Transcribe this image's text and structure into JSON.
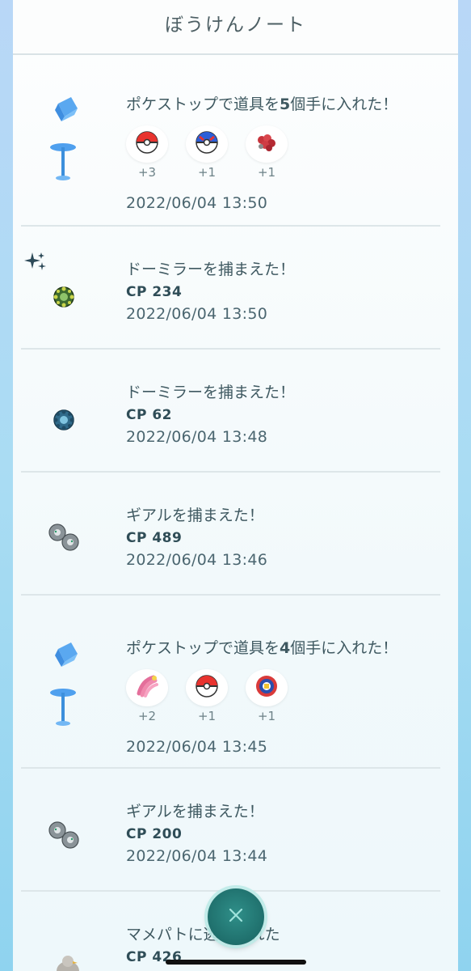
{
  "header": {
    "title": "ぼうけんノート"
  },
  "entries": [
    {
      "type": "pokestop",
      "message_pre": "ポケストップで道具を",
      "message_num": "5",
      "message_post": "個手に入れた！",
      "items": [
        {
          "icon": "poke-ball-icon",
          "count": "+3"
        },
        {
          "icon": "great-ball-icon",
          "count": "+1"
        },
        {
          "icon": "razz-berry-icon",
          "count": "+1"
        }
      ],
      "time": "2022/06/04 13:50"
    },
    {
      "type": "catch",
      "message": "ドーミラーを捕まえた！",
      "cp": "CP 234",
      "time": "2022/06/04 13:50",
      "shiny": true,
      "icon": "bronzor-icon"
    },
    {
      "type": "catch",
      "message": "ドーミラーを捕まえた！",
      "cp": "CP 62",
      "time": "2022/06/04 13:48",
      "icon": "bronzor-icon"
    },
    {
      "type": "catch",
      "message": "ギアルを捕まえた！",
      "cp": "CP 489",
      "time": "2022/06/04 13:46",
      "icon": "klink-icon"
    },
    {
      "type": "pokestop",
      "message_pre": "ポケストップで道具を",
      "message_num": "4",
      "message_post": "個手に入れた！",
      "items": [
        {
          "icon": "nanab-berry-icon",
          "count": "+2"
        },
        {
          "icon": "poke-ball-icon",
          "count": "+1"
        },
        {
          "icon": "gift-icon",
          "count": "+1"
        }
      ],
      "time": "2022/06/04 13:45"
    },
    {
      "type": "catch",
      "message": "ギアルを捕まえた！",
      "cp": "CP 200",
      "time": "2022/06/04 13:44",
      "icon": "klink-icon"
    },
    {
      "type": "fled",
      "message": "マメパトに逃げられた",
      "cp": "CP 426",
      "icon": "pidove-icon"
    }
  ],
  "close_button": {
    "icon": "close-icon"
  }
}
